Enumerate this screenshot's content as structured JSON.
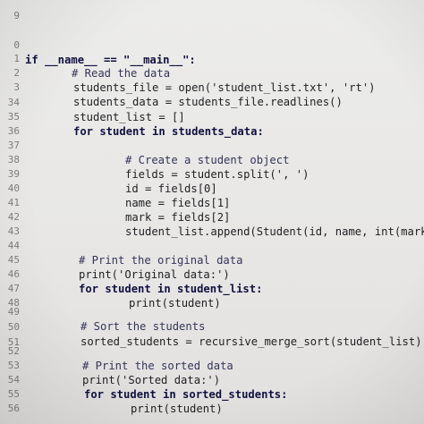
{
  "lines": [
    {
      "num": "9",
      "code": ""
    },
    {
      "num": "0",
      "code": "if __name__ == \"__main__\":"
    },
    {
      "num": "1",
      "code": "# Read the data"
    },
    {
      "num": "2",
      "code": "students_file = open('student_list.txt', 'rt')"
    },
    {
      "num": "3",
      "code": "students_data = students_file.readlines()"
    },
    {
      "num": "34",
      "code": "student_list = []"
    },
    {
      "num": "35",
      "code": "for student in students_data:"
    },
    {
      "num": "36",
      "code": ""
    },
    {
      "num": "37",
      "code": "# Create a student object"
    },
    {
      "num": "38",
      "code": "fields = student.split(', ')"
    },
    {
      "num": "39",
      "code": "id = fields[0]"
    },
    {
      "num": "40",
      "code": "name = fields[1]"
    },
    {
      "num": "41",
      "code": "mark = fields[2]"
    },
    {
      "num": "42",
      "code": "student_list.append(Student(id, name, int(mark)))"
    },
    {
      "num": "43",
      "code": ""
    },
    {
      "num": "44",
      "code": "# Print the original data"
    },
    {
      "num": "45",
      "code": "print('Original data:')"
    },
    {
      "num": "46",
      "code": "for student in student_list:"
    },
    {
      "num": "47",
      "code": "print(student)"
    },
    {
      "num": "48",
      "code": ""
    },
    {
      "num": "49",
      "code": "# Sort the students"
    },
    {
      "num": "50",
      "code": "sorted_students = recursive_merge_sort(student_list)"
    },
    {
      "num": "51",
      "code": ""
    },
    {
      "num": "52",
      "code": "# Print the sorted data"
    },
    {
      "num": "53",
      "code": "print('Sorted data:')"
    },
    {
      "num": "54",
      "code": "for student in sorted_students:"
    },
    {
      "num": "55",
      "code": "print(student)"
    },
    {
      "num": "56",
      "code": ""
    }
  ]
}
